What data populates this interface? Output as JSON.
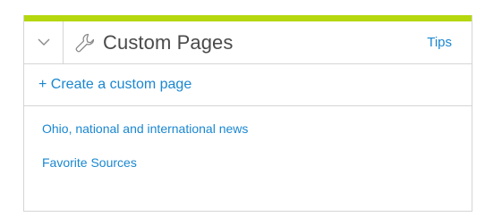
{
  "colors": {
    "accent": "#b5d70e",
    "link": "#1a87d0",
    "icon": "#8a8a8a"
  },
  "header": {
    "collapse_icon": "chevron-down-icon",
    "title_icon": "wrench-icon",
    "title": "Custom Pages",
    "tips_label": "Tips"
  },
  "actions": {
    "create_label": "+ Create a custom page"
  },
  "pages": [
    {
      "label": "Ohio, national and international news"
    },
    {
      "label": "Favorite Sources"
    }
  ]
}
